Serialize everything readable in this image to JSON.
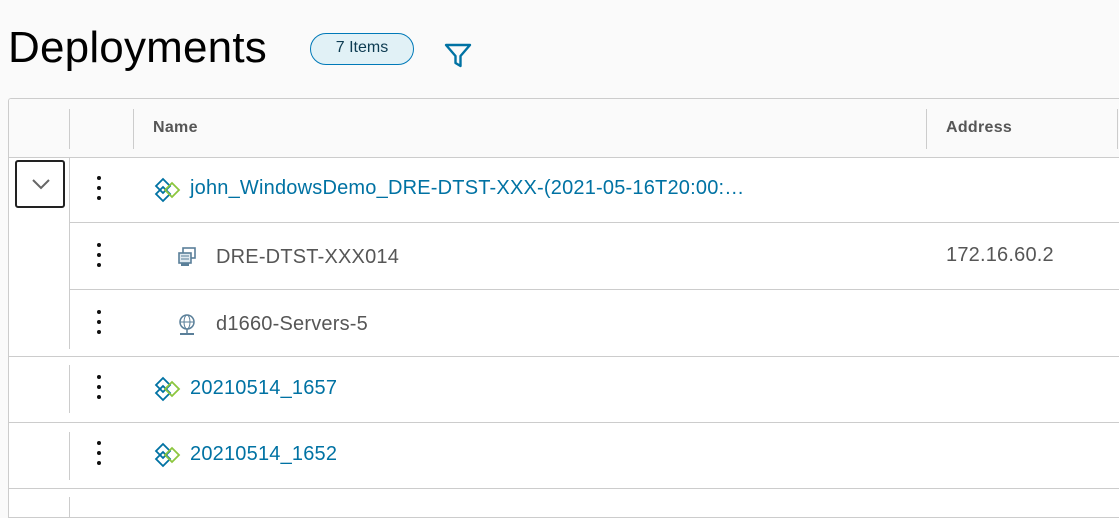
{
  "page": {
    "title": "Deployments",
    "item_count_label": "7 Items"
  },
  "table": {
    "columns": [
      "Name",
      "Address"
    ],
    "rows": [
      {
        "name": "john_WindowsDemo_DRE-DTST-XXX-(2021-05-16T20:00:…",
        "address": "",
        "type": "deployment",
        "expanded": true,
        "icon": "deployment-icon"
      },
      {
        "name": "DRE-DTST-XXX014",
        "address": "172.16.60.2",
        "type": "machine",
        "icon": "vm-icon"
      },
      {
        "name": "d1660-Servers-5",
        "address": "",
        "type": "network",
        "icon": "network-icon"
      },
      {
        "name": "20210514_1657",
        "address": "",
        "type": "deployment",
        "icon": "deployment-icon"
      },
      {
        "name": "20210514_1652",
        "address": "",
        "type": "deployment",
        "icon": "deployment-icon"
      }
    ]
  },
  "icons": {
    "filter": "filter-icon",
    "expand": "chevron-down-icon",
    "row_actions": "kebab-menu-icon"
  },
  "colors": {
    "link": "#0072a3",
    "badge_border": "#0079b8",
    "badge_bg": "#e1f1f6",
    "deploy_blue": "#0072a3",
    "deploy_green": "#8cc63f"
  }
}
